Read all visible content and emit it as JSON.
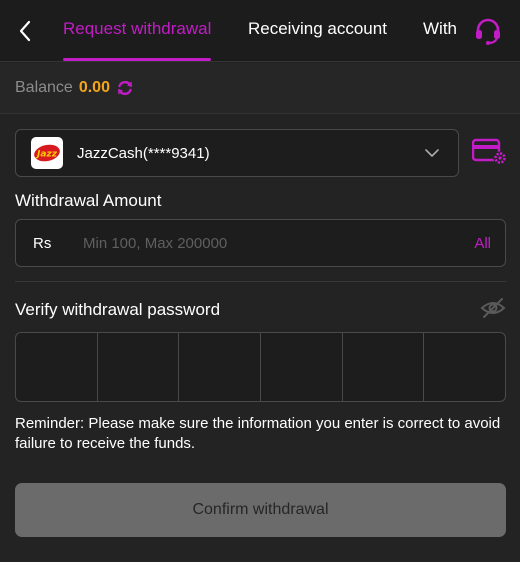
{
  "colors": {
    "accent": "#c21cc6",
    "balance": "#f3a51c",
    "background": "#232323"
  },
  "header": {
    "back_icon": "chevron-left-icon",
    "tabs": [
      {
        "label": "Request withdrawal",
        "active": true
      },
      {
        "label": "Receiving account",
        "active": false
      },
      {
        "label": "With",
        "active": false
      }
    ],
    "support_icon": "headset-icon"
  },
  "balance": {
    "label": "Balance",
    "value": "0.00",
    "refresh_icon": "refresh-icon"
  },
  "account": {
    "selected": "JazzCash(****9341)",
    "logo_text": "Jazz",
    "dropdown_icon": "chevron-down-icon",
    "settings_icon": "card-settings-icon"
  },
  "amount": {
    "title": "Withdrawal Amount",
    "currency": "Rs",
    "placeholder": "Min 100, Max 200000",
    "value": "",
    "all_label": "All"
  },
  "password": {
    "title": "Verify withdrawal password",
    "visibility_icon": "eye-off-icon",
    "digits": [
      "",
      "",
      "",
      "",
      "",
      ""
    ]
  },
  "reminder": "Reminder: Please make sure the information you enter is correct to avoid failure to receive the funds.",
  "confirm_label": "Confirm withdrawal"
}
